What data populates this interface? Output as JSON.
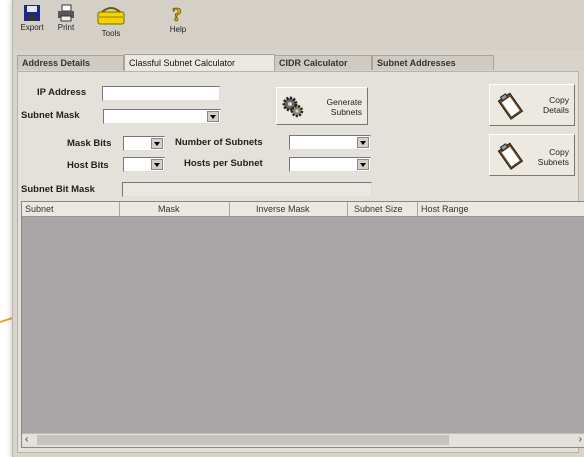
{
  "toolbar": {
    "items": [
      {
        "label": "Export",
        "icon": "floppy-disk-icon"
      },
      {
        "label": "Print",
        "icon": "printer-icon"
      },
      {
        "label": "Tools",
        "icon": "toolbox-icon"
      },
      {
        "label": "Help",
        "icon": "question-mark-icon"
      }
    ]
  },
  "tabs": [
    {
      "label": "Address Details",
      "active": false
    },
    {
      "label": "Classful Subnet Calculator",
      "active": true
    },
    {
      "label": "CIDR Calculator",
      "active": false
    },
    {
      "label": "Subnet Addresses",
      "active": false
    }
  ],
  "form": {
    "ip_address_label": "IP Address",
    "ip_address_value": "",
    "subnet_mask_label": "Subnet Mask",
    "subnet_mask_value": "",
    "mask_bits_label": "Mask Bits",
    "mask_bits_value": "",
    "host_bits_label": "Host Bits",
    "host_bits_value": "",
    "num_subnets_label": "Number of Subnets",
    "num_subnets_value": "",
    "hosts_per_subnet_label": "Hosts per Subnet",
    "hosts_per_subnet_value": "",
    "subnet_bit_mask_label": "Subnet Bit Mask",
    "subnet_bit_mask_value": ""
  },
  "buttons": {
    "generate": "Generate\nSubnets",
    "copy_details": "Copy\nDetails",
    "copy_subnets": "Copy\nSubnets"
  },
  "table": {
    "columns": [
      "Subnet",
      "Mask",
      "Inverse Mask",
      "Subnet Size",
      "Host Range"
    ],
    "rows": []
  },
  "colors": {
    "window_bg": "#d8d4cc",
    "list_bg": "#a8a6a6",
    "pointer_line": "#f0a030"
  }
}
